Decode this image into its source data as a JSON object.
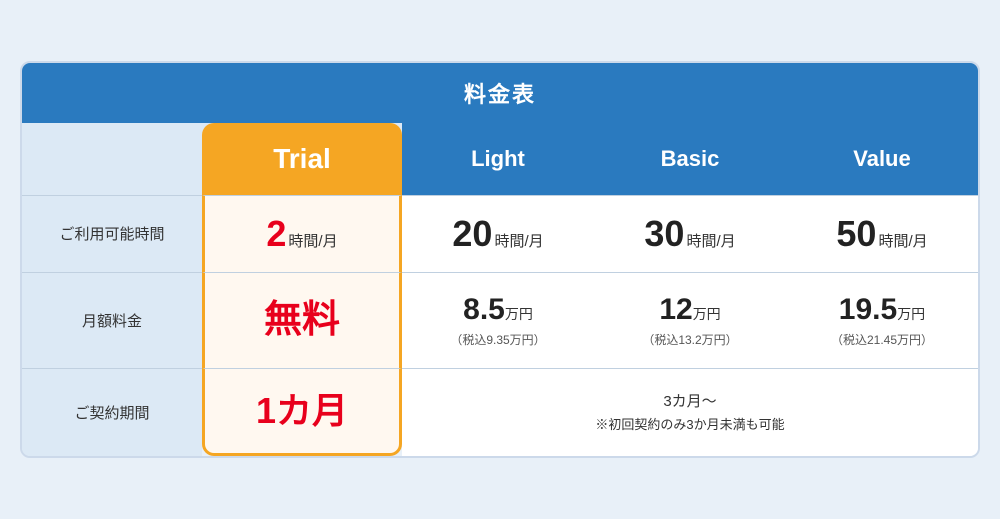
{
  "table": {
    "title": "料金表",
    "columns": {
      "trial": "Trial",
      "light": "Light",
      "basic": "Basic",
      "value": "Value"
    },
    "rows": {
      "usage_time": {
        "label": "ご利用可能時間",
        "trial": {
          "number": "2",
          "unit": "時間/月"
        },
        "light": {
          "number": "20",
          "unit": "時間/月"
        },
        "basic": {
          "number": "30",
          "unit": "時間/月"
        },
        "value": {
          "number": "50",
          "unit": "時間/月"
        }
      },
      "monthly_fee": {
        "label": "月額料金",
        "trial": {
          "text": "無料"
        },
        "light": {
          "price": "8.5",
          "unit": "万円",
          "tax": "（税込9.35万円）"
        },
        "basic": {
          "price": "12",
          "unit": "万円",
          "tax": "（税込13.2万円）"
        },
        "value": {
          "price": "19.5",
          "unit": "万円",
          "tax": "（税込21.45万円）"
        }
      },
      "contract_period": {
        "label": "ご契約期間",
        "trial": {
          "text": "1カ月"
        },
        "others": {
          "main": "3カ月〜",
          "note": "※初回契約のみ3か月未満も可能"
        }
      }
    }
  }
}
